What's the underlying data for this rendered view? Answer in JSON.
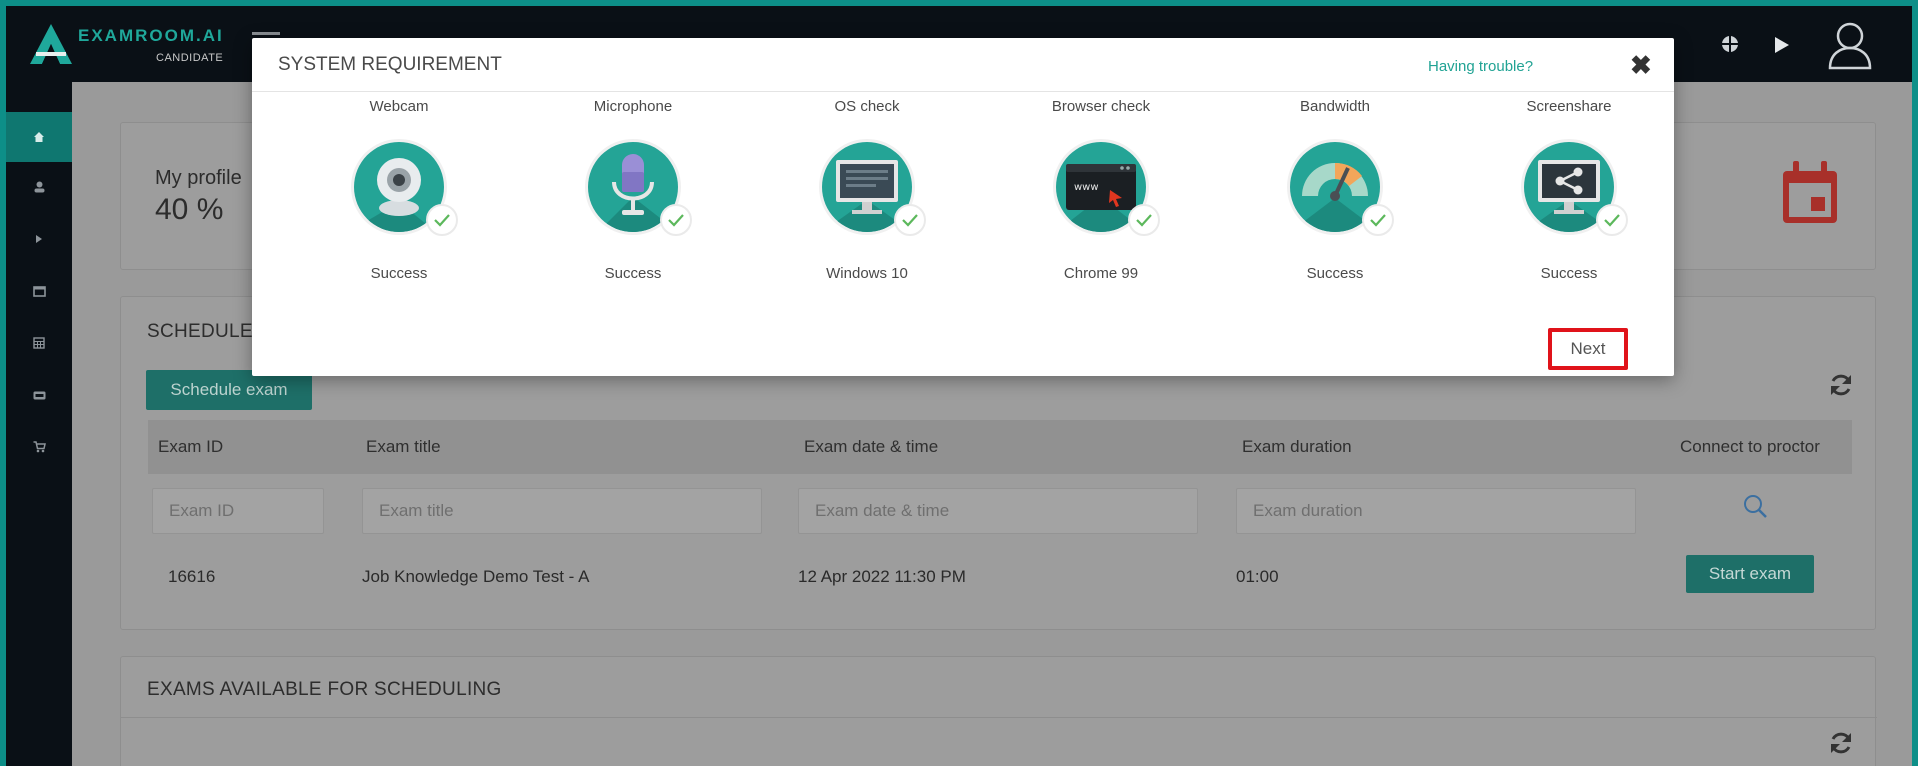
{
  "app": {
    "brand": "EXAMROOM.AI",
    "sub": "CANDIDATE",
    "accent": "#24a496",
    "highlight": "#e0131a"
  },
  "sidebar": {
    "items": [
      "home-icon",
      "user-icon",
      "play-icon",
      "window-icon",
      "calendar-icon",
      "ticket-icon",
      "cart-icon"
    ]
  },
  "profile": {
    "label": "My profile",
    "percent": "40 %"
  },
  "scheduled": {
    "title": "SCHEDULED",
    "schedule_button": "Schedule exam",
    "columns": [
      "Exam ID",
      "Exam title",
      "Exam date & time",
      "Exam duration",
      "Connect to proctor"
    ],
    "filters": [
      "Exam ID",
      "Exam title",
      "Exam date & time",
      "Exam duration"
    ],
    "row": {
      "id": "16616",
      "title": "Job Knowledge Demo Test - A",
      "datetime": "12 Apr 2022 11:30 PM",
      "duration": "01:00",
      "action": "Start exam"
    }
  },
  "available": {
    "title": "EXAMS AVAILABLE FOR SCHEDULING"
  },
  "modal": {
    "title": "SYSTEM REQUIREMENT",
    "trouble_link": "Having trouble?",
    "close": "✖",
    "next": "Next",
    "checks": [
      {
        "name": "Webcam",
        "status": "Success",
        "icon": "webcam-icon"
      },
      {
        "name": "Microphone",
        "status": "Success",
        "icon": "microphone-icon"
      },
      {
        "name": "OS check",
        "status": "Windows 10",
        "icon": "monitor-icon"
      },
      {
        "name": "Browser check",
        "status": "Chrome 99",
        "icon": "browser-icon"
      },
      {
        "name": "Bandwidth",
        "status": "Success",
        "icon": "gauge-icon"
      },
      {
        "name": "Screenshare",
        "status": "Success",
        "icon": "share-icon"
      }
    ]
  }
}
